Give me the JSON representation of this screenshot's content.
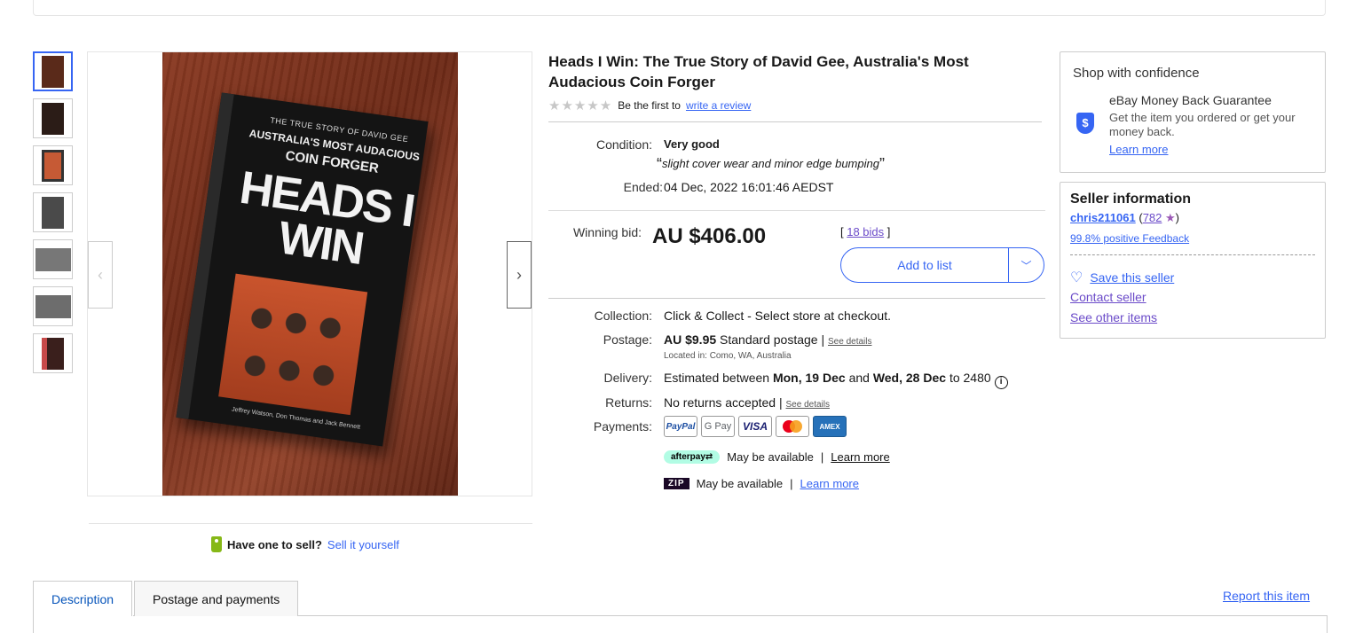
{
  "listing": {
    "title": "Heads I Win: The True Story of David Gee, Australia's Most Audacious Coin Forger",
    "rating_prefix": "Be the first to",
    "rating_link": "write a review",
    "stars": "★★★★★",
    "condition_label": "Condition:",
    "condition_value": "Very good",
    "condition_note": "slight cover wear and minor edge bumping",
    "ended_label": "Ended:",
    "ended_value": "04 Dec, 2022 16:01:46 AEDST",
    "bid_label": "Winning bid:",
    "price": "AU $406.00",
    "bids_link": "18 bids",
    "add_to_list": "Add to list",
    "collection_label": "Collection:",
    "collection_value": "Click & Collect - Select store at checkout.",
    "postage_label": "Postage:",
    "postage_price": "AU $9.95",
    "postage_type": "Standard postage",
    "see_details": "See details",
    "located": "Located in: Como, WA, Australia",
    "delivery_label": "Delivery:",
    "delivery_prefix": "Estimated between",
    "delivery_start": "Mon, 19 Dec",
    "delivery_and": "and",
    "delivery_end": "Wed, 28 Dec",
    "delivery_to": "to 2480",
    "returns_label": "Returns:",
    "returns_value": "No returns accepted",
    "payments_label": "Payments:",
    "payment_methods": [
      "PayPal",
      "G Pay",
      "VISA",
      "Mastercard",
      "AMEX"
    ],
    "afterpay_badge": "afterpay⇄",
    "afterpay_text": "May be available",
    "zip_badge": "ZIP",
    "zip_text": "May be available",
    "learn_more": "Learn more"
  },
  "image": {
    "cover_line1": "THE TRUE STORY OF DAVID GEE",
    "cover_line2": "AUSTRALIA'S MOST AUDACIOUS",
    "cover_line3": "COIN FORGER",
    "cover_title": "HEADS I WIN",
    "cover_authors": "Jeffrey Watson, Don Thomas and Jack Bennett",
    "thumb_colors": [
      "#5a2a1a",
      "#2b1c17",
      "#c65a35",
      "#4a4a4a",
      "#777777",
      "#6d6d6d",
      "#3a1f1c"
    ]
  },
  "sell": {
    "question": "Have one to sell?",
    "link": "Sell it yourself"
  },
  "confidence": {
    "heading": "Shop with confidence",
    "guarantee_title": "eBay Money Back Guarantee",
    "guarantee_text": "Get the item you ordered or get your money back.",
    "learn_more": "Learn more"
  },
  "seller": {
    "heading": "Seller information",
    "name": "chris211061",
    "feedback_count": "782",
    "positive": "99.8% positive Feedback",
    "save": "Save this seller",
    "contact": "Contact seller",
    "other": "See other items"
  },
  "tabs": {
    "description": "Description",
    "postage": "Postage and payments",
    "report": "Report this item"
  },
  "colors": {
    "accent": "#3665f3",
    "visited": "#6b4bc9"
  }
}
